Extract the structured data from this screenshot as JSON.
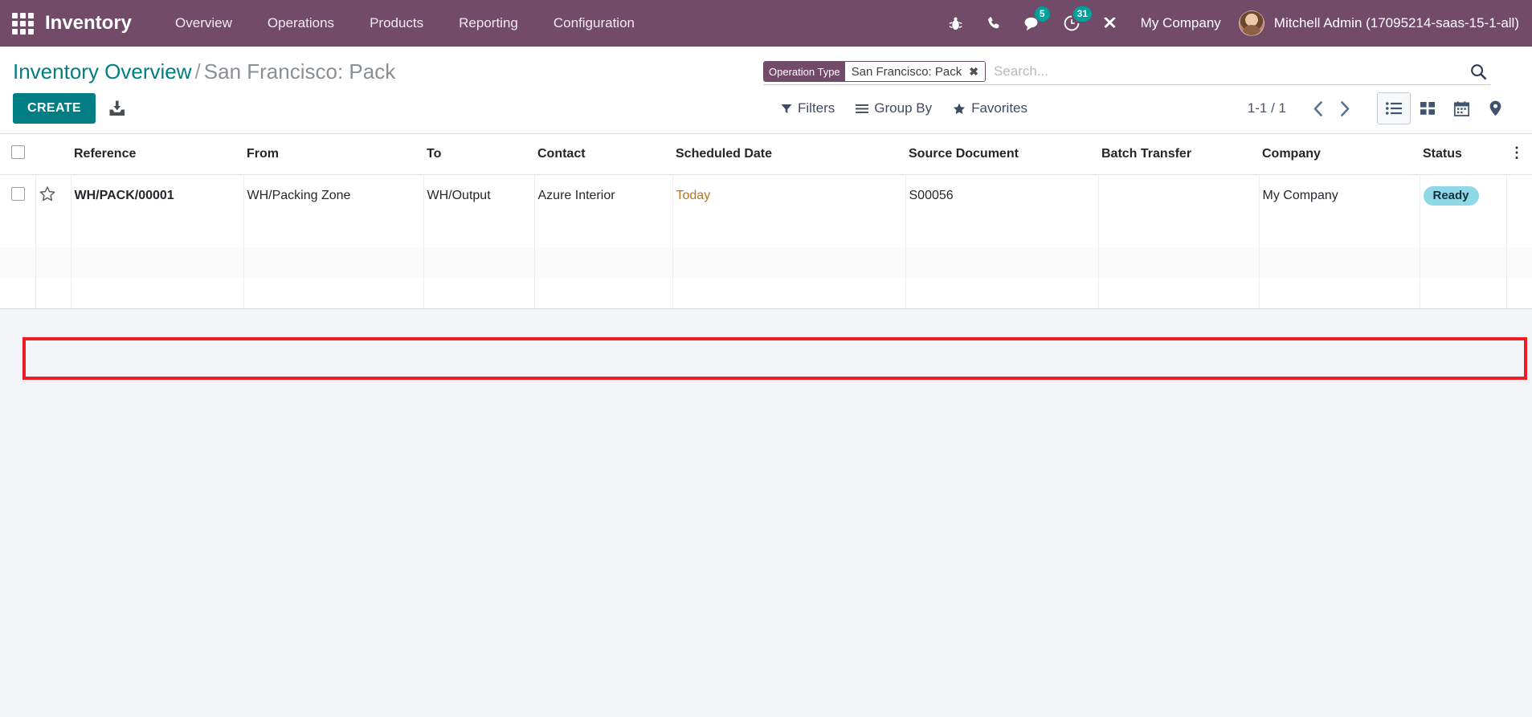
{
  "navbar": {
    "apps_icon": "apps-grid-icon",
    "brand": "Inventory",
    "menu": [
      {
        "label": "Overview"
      },
      {
        "label": "Operations"
      },
      {
        "label": "Products"
      },
      {
        "label": "Reporting"
      },
      {
        "label": "Configuration"
      }
    ],
    "sys_icons": [
      {
        "name": "bug-icon",
        "badge": null
      },
      {
        "name": "phone-icon",
        "badge": null
      },
      {
        "name": "messages-icon",
        "badge": "5"
      },
      {
        "name": "activities-clock-icon",
        "badge": "31"
      },
      {
        "name": "tools-icon",
        "badge": null
      }
    ],
    "company": "My Company",
    "user": "Mitchell Admin (17095214-saas-15-1-all)",
    "bg_color": "#714b67",
    "badge_color": "#00a09d"
  },
  "control_panel": {
    "breadcrumb": {
      "root": "Inventory Overview",
      "separator": "/",
      "current": "San Francisco: Pack"
    },
    "create_label": "CREATE",
    "import_icon": "import-icon",
    "search": {
      "facet_label": "Operation Type",
      "facet_value": "San Francisco: Pack",
      "facet_remove": "✖",
      "placeholder": "Search...",
      "value": "",
      "magnifier_icon": "search-icon"
    },
    "filters": [
      {
        "label": "Filters",
        "icon": "funnel-icon"
      },
      {
        "label": "Group By",
        "icon": "hamburger-icon"
      },
      {
        "label": "Favorites",
        "icon": "star-icon"
      }
    ],
    "pager": {
      "value": "1-1 / 1",
      "prev_icon": "chevron-left-icon",
      "next_icon": "chevron-right-icon"
    },
    "views": [
      {
        "name": "list",
        "icon": "list-view-icon",
        "active": true
      },
      {
        "name": "kanban",
        "icon": "kanban-view-icon",
        "active": false
      },
      {
        "name": "calendar",
        "icon": "calendar-view-icon",
        "active": false
      },
      {
        "name": "map",
        "icon": "map-pin-view-icon",
        "active": false
      }
    ]
  },
  "list": {
    "columns": [
      "Reference",
      "From",
      "To",
      "Contact",
      "Scheduled Date",
      "Source Document",
      "Batch Transfer",
      "Company",
      "Status"
    ],
    "optional_columns_icon": "vertical-dots-icon",
    "rows": [
      {
        "reference": "WH/PACK/00001",
        "from": "WH/Packing Zone",
        "to": "WH/Output",
        "contact": "Azure Interior",
        "scheduled_date": "Today",
        "source_document": "S00056",
        "batch_transfer": "",
        "company": "My Company",
        "status": "Ready"
      }
    ],
    "highlight_color": "#ee1c25",
    "status_badge_color": "#8fd8e8",
    "date_color": "#b8741c"
  }
}
